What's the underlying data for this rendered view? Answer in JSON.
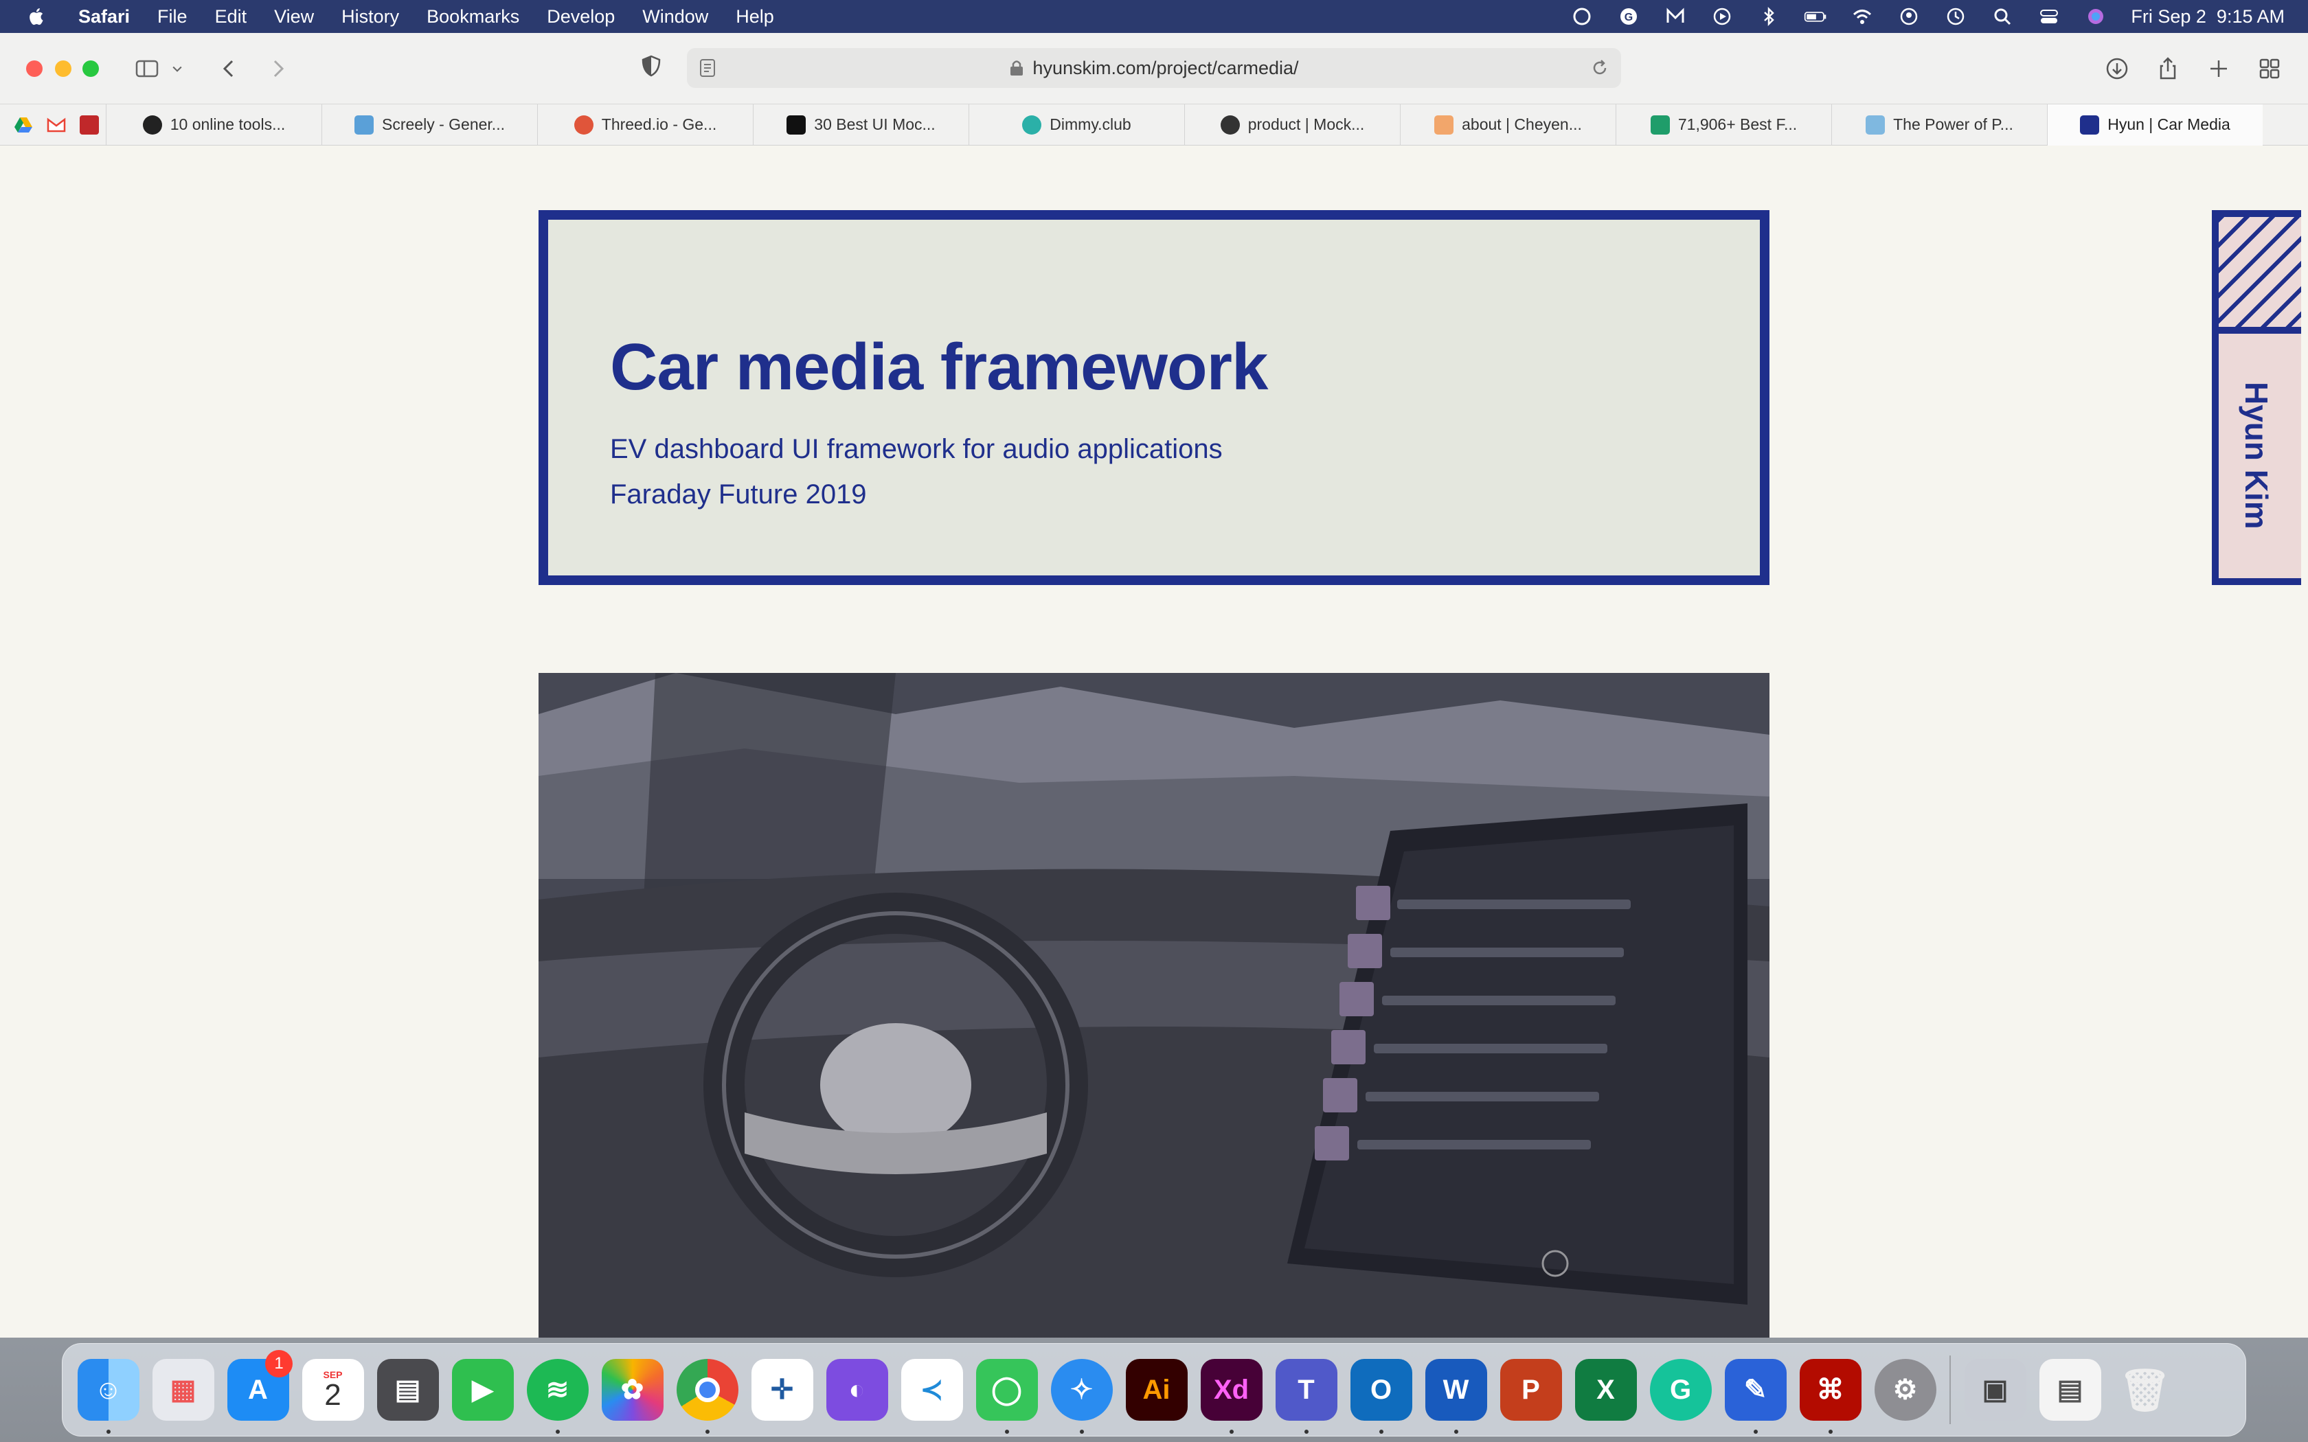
{
  "menubar": {
    "app": "Safari",
    "items": [
      "File",
      "Edit",
      "View",
      "History",
      "Bookmarks",
      "Develop",
      "Window",
      "Help"
    ],
    "datetime": "Fri Sep 2  9:15 AM"
  },
  "toolbar": {
    "url": "hyunskim.com/project/carmedia/"
  },
  "favorites": [
    {
      "label": "10 online tools...",
      "color": "#222222"
    },
    {
      "label": "Screely - Gener...",
      "color": "#5aa0d8"
    },
    {
      "label": "Threed.io - Ge...",
      "color": "#e0553a"
    },
    {
      "label": "30 Best UI Moc...",
      "color": "#111111"
    },
    {
      "label": "Dimmy.club",
      "color": "#2bb0a8"
    },
    {
      "label": "product | Mock...",
      "color": "#333333"
    },
    {
      "label": "about | Cheyen...",
      "color": "#f2a66b"
    },
    {
      "label": "71,906+ Best F...",
      "color": "#1f9d6a"
    },
    {
      "label": "The Power of P...",
      "color": "#7fb8e0"
    },
    {
      "label": "Hyun | Car Media",
      "color": "#1f2f8c"
    }
  ],
  "hero": {
    "title": "Car media framework",
    "subtitle": "EV dashboard UI framework for audio applications",
    "meta": "Faraday Future 2019"
  },
  "sidetab": {
    "name": "Hyun Kim"
  },
  "dock": {
    "appstore_badge": "1",
    "calendar_month": "SEP",
    "calendar_day": "2"
  }
}
